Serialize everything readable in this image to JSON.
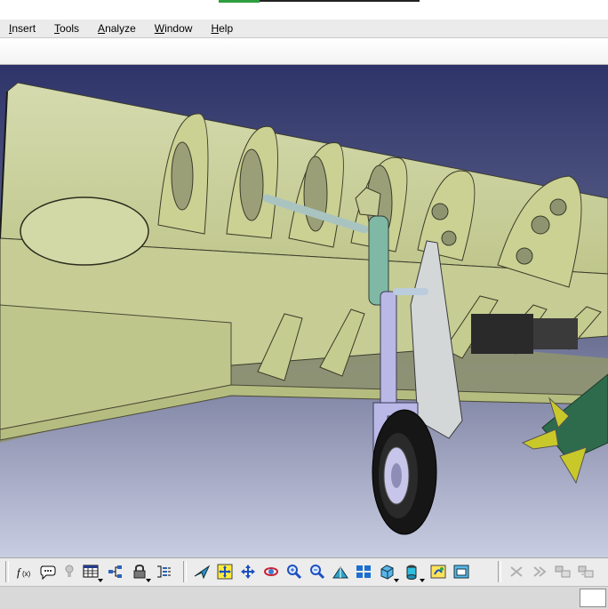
{
  "menu": {
    "items": [
      {
        "label": "Insert",
        "key": "insert"
      },
      {
        "label": "Tools",
        "key": "tools"
      },
      {
        "label": "Analyze",
        "key": "analyze"
      },
      {
        "label": "Window",
        "key": "window"
      },
      {
        "label": "Help",
        "key": "help"
      }
    ]
  },
  "viewport": {
    "background_top": "#2e3469",
    "background_bottom": "#c9cde2",
    "model": "wing-structure-with-landing-gear"
  },
  "toolbar": {
    "groups": [
      {
        "icons": [
          "formula-icon",
          "comment-icon",
          "knowledge-icon",
          "table-icon",
          "graph-tree-icon",
          "lock-icon",
          "parameters-icon"
        ]
      },
      {
        "icons": [
          "fly-mode-icon",
          "fit-all-icon",
          "pan-icon",
          "rotate-icon",
          "zoom-in-icon",
          "zoom-out-icon",
          "normal-view-icon",
          "multi-view-icon",
          "iso-view-icon",
          "shading-icon",
          "hide-show-icon",
          "swap-space-icon"
        ]
      },
      {
        "icons": [
          "stop-icon",
          "forward-icon",
          "catalog-icon",
          "chapter-icon"
        ]
      }
    ]
  },
  "colors": {
    "wing_skin": "#cfd6a2",
    "rib": "#c7ce93",
    "strut": "#b9b8e6",
    "tire": "#1a1a1a",
    "missile": "#2d6b4c",
    "fin": "#c9c82b"
  }
}
